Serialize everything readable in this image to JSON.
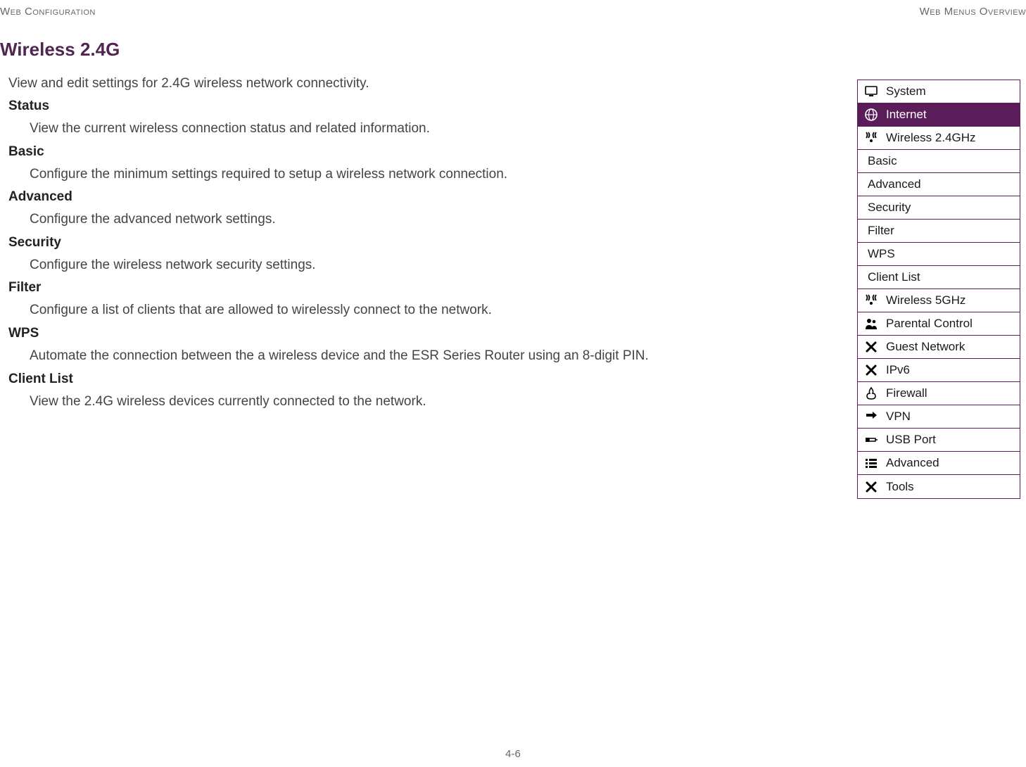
{
  "header": {
    "left": "Web Configuration",
    "right": "Web Menus Overview"
  },
  "title": "Wireless 2.4G",
  "intro": "View and edit settings for 2.4G wireless network connectivity.",
  "sections": {
    "status": {
      "title": "Status",
      "desc": "View the current wireless connection status and related information."
    },
    "basic": {
      "title": "Basic",
      "desc": "Configure the minimum settings required to setup a wireless network connection."
    },
    "advanced": {
      "title": "Advanced",
      "desc": "Configure the advanced network settings."
    },
    "security": {
      "title": "Security",
      "desc": "Configure the wireless network security settings."
    },
    "filter": {
      "title": "Filter",
      "desc": "Configure a list of clients that are allowed to wirelessly connect to the network."
    },
    "wps": {
      "title": "WPS",
      "desc": "Automate the connection between the a wireless device and the ESR Series Router using an 8-digit PIN."
    },
    "clientlist": {
      "title": "Client List",
      "desc": "View the 2.4G wireless devices currently connected to the network."
    }
  },
  "menu": {
    "system": "System",
    "internet": "Internet",
    "wireless24": "Wireless 2.4GHz",
    "sub_basic": "Basic",
    "sub_advanced": "Advanced",
    "sub_security": "Security",
    "sub_filter": "Filter",
    "sub_wps": "WPS",
    "sub_clientlist": "Client List",
    "wireless5": "Wireless 5GHz",
    "parental": "Parental Control",
    "guest": "Guest Network",
    "ipv6": "IPv6",
    "firewall": "Firewall",
    "vpn": "VPN",
    "usb": "USB Port",
    "advanced": "Advanced",
    "tools": "Tools"
  },
  "pageNumber": "4-6"
}
